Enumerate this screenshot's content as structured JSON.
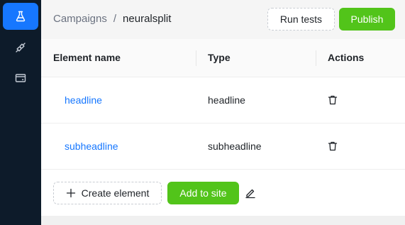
{
  "sidebar": {
    "items": [
      {
        "icon": "flask-icon",
        "active": true
      },
      {
        "icon": "plug-icon",
        "active": false
      },
      {
        "icon": "card-icon",
        "active": false
      }
    ]
  },
  "header": {
    "breadcrumb": {
      "parent": "Campaigns",
      "separator": "/",
      "current": "neuralsplit"
    },
    "run_tests_label": "Run tests",
    "publish_label": "Publish"
  },
  "table": {
    "columns": {
      "name": "Element name",
      "type": "Type",
      "actions": "Actions"
    },
    "rows": [
      {
        "name": "headline",
        "type": "headline"
      },
      {
        "name": "subheadline",
        "type": "subheadline"
      }
    ]
  },
  "footer": {
    "create_label": "Create element",
    "add_label": "Add to site"
  },
  "colors": {
    "sidebar_bg": "#0d1b2a",
    "accent": "#1677ff",
    "success": "#52c41a"
  }
}
